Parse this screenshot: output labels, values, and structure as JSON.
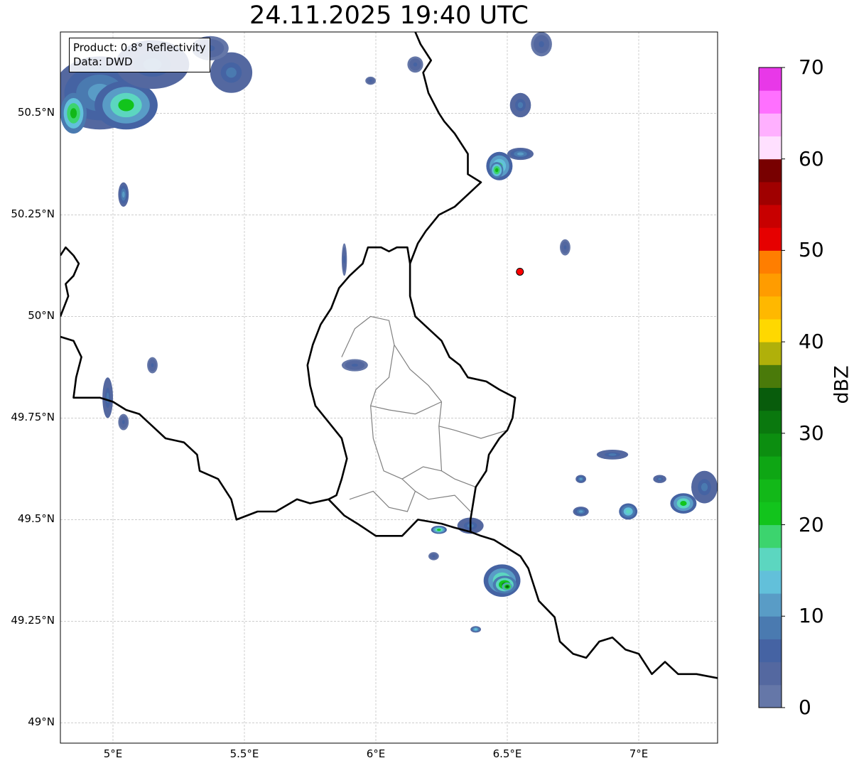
{
  "map": {
    "title": "24.11.2025 19:40 UTC",
    "info": {
      "product": "Product: 0.8° Reflectivity",
      "data": "Data: DWD"
    },
    "bounds": {
      "lon_min": 4.8,
      "lon_max": 7.3,
      "lat_min": 48.95,
      "lat_max": 50.7
    },
    "lat_ticks": [
      {
        "value": 50.5,
        "label": "50.5°N"
      },
      {
        "value": 50.25,
        "label": "50.25°N"
      },
      {
        "value": 50.0,
        "label": "50°N"
      },
      {
        "value": 49.75,
        "label": "49.75°N"
      },
      {
        "value": 49.5,
        "label": "49.5°N"
      },
      {
        "value": 49.25,
        "label": "49.25°N"
      },
      {
        "value": 49.0,
        "label": "49°N"
      }
    ],
    "lon_ticks": [
      {
        "value": 5.0,
        "label": "5°E"
      },
      {
        "value": 5.5,
        "label": "5.5°E"
      },
      {
        "value": 6.0,
        "label": "6°E"
      },
      {
        "value": 6.5,
        "label": "6.5°E"
      },
      {
        "value": 7.0,
        "label": "7°E"
      }
    ],
    "radar_site": {
      "lon": 6.548,
      "lat": 50.11,
      "color": "#ff0000"
    }
  },
  "colorbar": {
    "label": "dBZ",
    "min": 0,
    "max": 70,
    "step": 2.5,
    "ticks": [
      {
        "value": 0,
        "label": "0"
      },
      {
        "value": 10,
        "label": "10"
      },
      {
        "value": 20,
        "label": "20"
      },
      {
        "value": 30,
        "label": "30"
      },
      {
        "value": 40,
        "label": "40"
      },
      {
        "value": 50,
        "label": "50"
      },
      {
        "value": 60,
        "label": "60"
      },
      {
        "value": 70,
        "label": "70"
      }
    ],
    "colors": [
      "#6577a8",
      "#5468a0",
      "#4563a3",
      "#4a7ab0",
      "#599cc6",
      "#62c0da",
      "#5cd6c0",
      "#3cd46e",
      "#12c41c",
      "#12b818",
      "#0ea614",
      "#0c8e10",
      "#0a780e",
      "#085c0c",
      "#4a7a0a",
      "#b0b00a",
      "#ffd800",
      "#ffb800",
      "#ff9c00",
      "#ff7e00",
      "#e60000",
      "#c80000",
      "#a00000",
      "#780000",
      "#ffe0ff",
      "#ffb0ff",
      "#ff70ff",
      "#e838e8"
    ]
  },
  "echoes": [
    {
      "lon": 4.95,
      "lat": 50.55,
      "rlon": 0.18,
      "rlat": 0.09,
      "dbz": 12
    },
    {
      "lon": 5.05,
      "lat": 50.52,
      "rlon": 0.12,
      "rlat": 0.06,
      "dbz": 20
    },
    {
      "lon": 4.85,
      "lat": 50.5,
      "rlon": 0.05,
      "rlat": 0.05,
      "dbz": 24
    },
    {
      "lon": 5.15,
      "lat": 50.62,
      "rlon": 0.14,
      "rlat": 0.06,
      "dbz": 8
    },
    {
      "lon": 5.45,
      "lat": 50.6,
      "rlon": 0.08,
      "rlat": 0.05,
      "dbz": 8
    },
    {
      "lon": 5.37,
      "lat": 50.66,
      "rlon": 0.07,
      "rlat": 0.03,
      "dbz": 6
    },
    {
      "lon": 5.04,
      "lat": 50.3,
      "rlon": 0.02,
      "rlat": 0.03,
      "dbz": 12
    },
    {
      "lon": 6.47,
      "lat": 50.37,
      "rlon": 0.05,
      "rlat": 0.035,
      "dbz": 18
    },
    {
      "lon": 6.46,
      "lat": 50.36,
      "rlon": 0.025,
      "rlat": 0.02,
      "dbz": 24
    },
    {
      "lon": 6.55,
      "lat": 50.4,
      "rlon": 0.05,
      "rlat": 0.015,
      "dbz": 10
    },
    {
      "lon": 6.55,
      "lat": 50.52,
      "rlon": 0.04,
      "rlat": 0.03,
      "dbz": 8
    },
    {
      "lon": 6.63,
      "lat": 50.67,
      "rlon": 0.04,
      "rlat": 0.03,
      "dbz": 6
    },
    {
      "lon": 6.15,
      "lat": 50.62,
      "rlon": 0.03,
      "rlat": 0.02,
      "dbz": 6
    },
    {
      "lon": 5.98,
      "lat": 50.58,
      "rlon": 0.02,
      "rlat": 0.01,
      "dbz": 6
    },
    {
      "lon": 6.48,
      "lat": 49.35,
      "rlon": 0.07,
      "rlat": 0.04,
      "dbz": 20
    },
    {
      "lon": 6.49,
      "lat": 49.34,
      "rlon": 0.045,
      "rlat": 0.022,
      "dbz": 28
    },
    {
      "lon": 6.5,
      "lat": 49.335,
      "rlon": 0.02,
      "rlat": 0.01,
      "dbz": 34
    },
    {
      "lon": 6.36,
      "lat": 49.485,
      "rlon": 0.05,
      "rlat": 0.02,
      "dbz": 8
    },
    {
      "lon": 6.24,
      "lat": 49.475,
      "rlon": 0.03,
      "rlat": 0.01,
      "dbz": 20
    },
    {
      "lon": 6.22,
      "lat": 49.41,
      "rlon": 0.02,
      "rlat": 0.01,
      "dbz": 6
    },
    {
      "lon": 6.38,
      "lat": 49.23,
      "rlon": 0.02,
      "rlat": 0.008,
      "dbz": 14
    },
    {
      "lon": 7.17,
      "lat": 49.54,
      "rlon": 0.05,
      "rlat": 0.025,
      "dbz": 20
    },
    {
      "lon": 7.25,
      "lat": 49.58,
      "rlon": 0.05,
      "rlat": 0.04,
      "dbz": 8
    },
    {
      "lon": 6.96,
      "lat": 49.52,
      "rlon": 0.035,
      "rlat": 0.02,
      "dbz": 16
    },
    {
      "lon": 6.9,
      "lat": 49.66,
      "rlon": 0.06,
      "rlat": 0.012,
      "dbz": 8
    },
    {
      "lon": 6.78,
      "lat": 49.52,
      "rlon": 0.03,
      "rlat": 0.012,
      "dbz": 12
    },
    {
      "lon": 6.78,
      "lat": 49.6,
      "rlon": 0.02,
      "rlat": 0.01,
      "dbz": 12
    },
    {
      "lon": 7.08,
      "lat": 49.6,
      "rlon": 0.025,
      "rlat": 0.01,
      "dbz": 8
    },
    {
      "lon": 4.98,
      "lat": 49.8,
      "rlon": 0.02,
      "rlat": 0.05,
      "dbz": 8
    },
    {
      "lon": 5.04,
      "lat": 49.74,
      "rlon": 0.02,
      "rlat": 0.02,
      "dbz": 6
    },
    {
      "lon": 5.15,
      "lat": 49.88,
      "rlon": 0.02,
      "rlat": 0.02,
      "dbz": 6
    },
    {
      "lon": 5.92,
      "lat": 49.88,
      "rlon": 0.05,
      "rlat": 0.015,
      "dbz": 6
    },
    {
      "lon": 5.88,
      "lat": 50.14,
      "rlon": 0.01,
      "rlat": 0.04,
      "dbz": 6
    },
    {
      "lon": 6.72,
      "lat": 50.17,
      "rlon": 0.02,
      "rlat": 0.02,
      "dbz": 6
    }
  ],
  "borders": {
    "national": [
      [
        [
          4.8,
          50.15
        ],
        [
          4.82,
          50.17
        ],
        [
          4.85,
          50.15
        ],
        [
          4.87,
          50.13
        ],
        [
          4.85,
          50.1
        ],
        [
          4.82,
          50.08
        ],
        [
          4.83,
          50.05
        ],
        [
          4.8,
          50.0
        ]
      ],
      [
        [
          4.8,
          49.95
        ],
        [
          4.85,
          49.94
        ],
        [
          4.88,
          49.9
        ],
        [
          4.86,
          49.85
        ],
        [
          4.85,
          49.8
        ],
        [
          4.9,
          49.8
        ],
        [
          4.95,
          49.8
        ],
        [
          5.0,
          49.79
        ],
        [
          5.05,
          49.77
        ],
        [
          5.1,
          49.76
        ],
        [
          5.15,
          49.73
        ],
        [
          5.2,
          49.7
        ],
        [
          5.27,
          49.69
        ],
        [
          5.32,
          49.66
        ],
        [
          5.33,
          49.62
        ],
        [
          5.4,
          49.6
        ],
        [
          5.45,
          49.55
        ],
        [
          5.47,
          49.5
        ],
        [
          5.55,
          49.52
        ],
        [
          5.62,
          49.52
        ],
        [
          5.7,
          49.55
        ],
        [
          5.75,
          49.54
        ],
        [
          5.82,
          49.55
        ],
        [
          5.88,
          49.51
        ],
        [
          5.93,
          49.49
        ],
        [
          6.0,
          49.46
        ],
        [
          6.05,
          49.46
        ],
        [
          6.1,
          49.46
        ],
        [
          6.16,
          49.5
        ],
        [
          6.25,
          49.49
        ],
        [
          6.3,
          49.48
        ],
        [
          6.36,
          49.47
        ],
        [
          6.4,
          49.46
        ],
        [
          6.45,
          49.45
        ],
        [
          6.5,
          49.43
        ],
        [
          6.55,
          49.41
        ],
        [
          6.58,
          49.38
        ],
        [
          6.6,
          49.34
        ],
        [
          6.62,
          49.3
        ],
        [
          6.65,
          49.28
        ],
        [
          6.68,
          49.26
        ],
        [
          6.7,
          49.2
        ],
        [
          6.75,
          49.17
        ],
        [
          6.8,
          49.16
        ],
        [
          6.85,
          49.2
        ],
        [
          6.9,
          49.21
        ],
        [
          6.95,
          49.18
        ],
        [
          7.0,
          49.17
        ],
        [
          7.05,
          49.12
        ],
        [
          7.1,
          49.15
        ],
        [
          7.15,
          49.12
        ],
        [
          7.22,
          49.12
        ],
        [
          7.3,
          49.11
        ]
      ],
      [
        [
          6.36,
          49.47
        ],
        [
          6.36,
          49.5
        ],
        [
          6.37,
          49.54
        ],
        [
          6.38,
          49.58
        ],
        [
          6.42,
          49.62
        ],
        [
          6.43,
          49.66
        ],
        [
          6.47,
          49.7
        ],
        [
          6.5,
          49.72
        ],
        [
          6.52,
          49.75
        ],
        [
          6.53,
          49.8
        ],
        [
          6.5,
          49.81
        ],
        [
          6.47,
          49.82
        ],
        [
          6.42,
          49.84
        ],
        [
          6.35,
          49.85
        ],
        [
          6.32,
          49.88
        ],
        [
          6.28,
          49.9
        ],
        [
          6.25,
          49.94
        ],
        [
          6.2,
          49.97
        ],
        [
          6.15,
          50.0
        ],
        [
          6.13,
          50.05
        ],
        [
          6.13,
          50.13
        ],
        [
          6.12,
          50.17
        ],
        [
          6.08,
          50.17
        ],
        [
          6.05,
          50.16
        ],
        [
          6.02,
          50.17
        ],
        [
          5.97,
          50.17
        ],
        [
          5.95,
          50.13
        ],
        [
          5.9,
          50.1
        ],
        [
          5.86,
          50.07
        ],
        [
          5.83,
          50.02
        ],
        [
          5.79,
          49.98
        ],
        [
          5.76,
          49.93
        ],
        [
          5.74,
          49.88
        ],
        [
          5.75,
          49.83
        ],
        [
          5.77,
          49.78
        ],
        [
          5.82,
          49.74
        ],
        [
          5.87,
          49.7
        ],
        [
          5.89,
          49.65
        ],
        [
          5.87,
          49.6
        ],
        [
          5.85,
          49.56
        ],
        [
          5.82,
          49.55
        ]
      ],
      [
        [
          6.15,
          50.7
        ],
        [
          6.17,
          50.67
        ],
        [
          6.21,
          50.63
        ],
        [
          6.18,
          50.6
        ],
        [
          6.2,
          50.55
        ],
        [
          6.24,
          50.5
        ],
        [
          6.26,
          50.48
        ],
        [
          6.3,
          50.45
        ],
        [
          6.35,
          50.4
        ],
        [
          6.35,
          50.35
        ],
        [
          6.4,
          50.33
        ],
        [
          6.35,
          50.3
        ],
        [
          6.3,
          50.27
        ],
        [
          6.24,
          50.25
        ],
        [
          6.19,
          50.21
        ],
        [
          6.16,
          50.18
        ],
        [
          6.13,
          50.13
        ]
      ]
    ],
    "admin": [
      [
        [
          5.87,
          49.9
        ],
        [
          5.92,
          49.97
        ],
        [
          5.98,
          50.0
        ],
        [
          6.05,
          49.99
        ],
        [
          6.07,
          49.93
        ]
      ],
      [
        [
          6.07,
          49.93
        ],
        [
          6.05,
          49.85
        ],
        [
          6.0,
          49.82
        ],
        [
          5.98,
          49.78
        ]
      ],
      [
        [
          6.07,
          49.93
        ],
        [
          6.1,
          49.9
        ],
        [
          6.13,
          49.87
        ],
        [
          6.2,
          49.83
        ],
        [
          6.25,
          49.79
        ]
      ],
      [
        [
          5.98,
          49.78
        ],
        [
          6.05,
          49.77
        ],
        [
          6.15,
          49.76
        ],
        [
          6.25,
          49.79
        ]
      ],
      [
        [
          5.98,
          49.78
        ],
        [
          5.99,
          49.7
        ],
        [
          6.03,
          49.62
        ],
        [
          6.1,
          49.6
        ],
        [
          6.18,
          49.63
        ],
        [
          6.25,
          49.62
        ]
      ],
      [
        [
          6.25,
          49.79
        ],
        [
          6.24,
          49.73
        ],
        [
          6.3,
          49.72
        ],
        [
          6.4,
          49.7
        ],
        [
          6.5,
          49.72
        ]
      ],
      [
        [
          6.24,
          49.73
        ],
        [
          6.25,
          49.62
        ],
        [
          6.3,
          49.6
        ],
        [
          6.38,
          49.58
        ]
      ],
      [
        [
          6.15,
          49.57
        ],
        [
          6.12,
          49.52
        ],
        [
          6.05,
          49.53
        ],
        [
          5.99,
          49.57
        ],
        [
          5.9,
          49.55
        ]
      ],
      [
        [
          6.1,
          49.6
        ],
        [
          6.15,
          49.57
        ],
        [
          6.2,
          49.55
        ],
        [
          6.3,
          49.56
        ],
        [
          6.36,
          49.52
        ]
      ]
    ]
  }
}
